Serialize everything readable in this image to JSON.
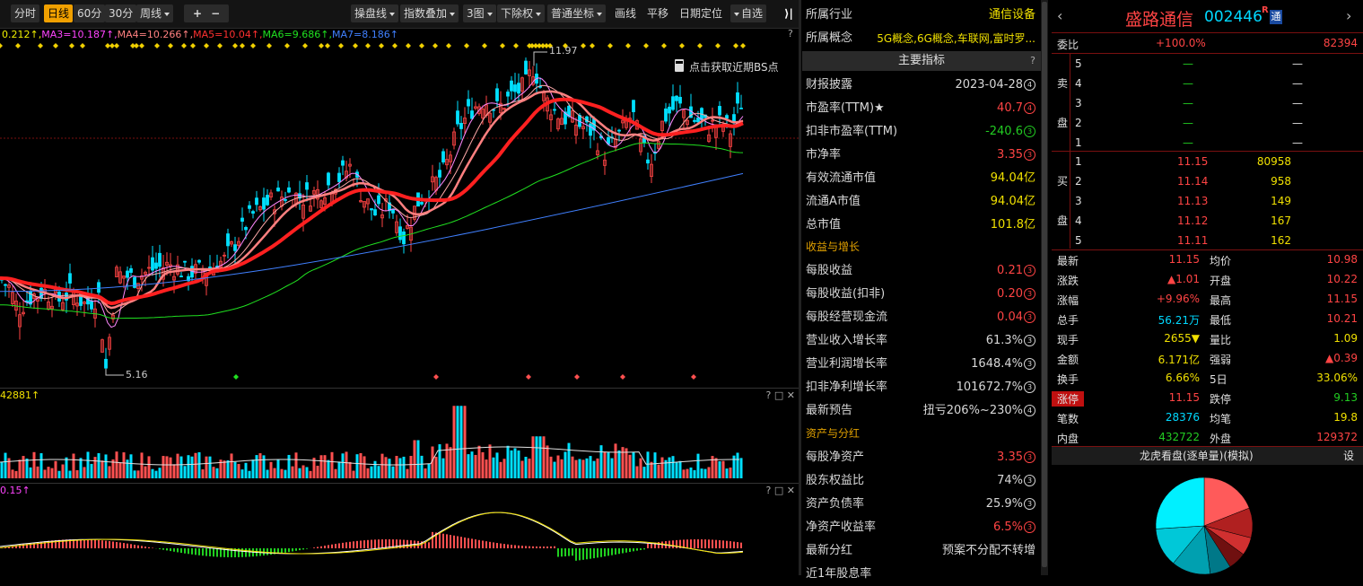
{
  "toolbar": {
    "tabs": [
      "分时",
      "日线",
      "60分",
      "30分",
      "周线"
    ],
    "active_tab": "日线",
    "plus": "+",
    "minus": "−",
    "tools": [
      "操盘线",
      "指数叠加",
      "3图",
      "下除权",
      "普通坐标",
      "画线",
      "平移",
      "日期定位",
      "自选"
    ]
  },
  "ma_legend": [
    {
      "text": "0.212↑,",
      "color": "#f0f000"
    },
    {
      "text": "MA3=10.187↑,",
      "color": "#ff44ff"
    },
    {
      "text": "MA4=10.266↑,",
      "color": "#ff8080"
    },
    {
      "text": "MA5=10.04↑,",
      "color": "#ff2020"
    },
    {
      "text": "MA6=9.686↑,",
      "color": "#20e020"
    },
    {
      "text": "MA7=8.186↑",
      "color": "#4080ff"
    }
  ],
  "chart": {
    "lock_hint": "点击获取近期BS点",
    "high_label": "11.97",
    "low_label": "5.16",
    "volume_legend": "42881↑",
    "macd_legend": "0.15↑",
    "question": "?"
  },
  "chart_data": {
    "type": "candlestick",
    "ylim": [
      4.9,
      12.4
    ],
    "price_points": [
      [
        0,
        7.2
      ],
      [
        10,
        7.0
      ],
      [
        20,
        6.5
      ],
      [
        35,
        6.8
      ],
      [
        50,
        6.9
      ],
      [
        65,
        6.7
      ],
      [
        80,
        6.9
      ],
      [
        95,
        6.6
      ],
      [
        110,
        6.8
      ],
      [
        118,
        5.16
      ],
      [
        130,
        7.3
      ],
      [
        150,
        7.2
      ],
      [
        170,
        7.4
      ],
      [
        190,
        7.5
      ],
      [
        210,
        7.3
      ],
      [
        230,
        7.4
      ],
      [
        250,
        7.6
      ],
      [
        265,
        8.1
      ],
      [
        280,
        8.6
      ],
      [
        300,
        8.9
      ],
      [
        320,
        9.1
      ],
      [
        340,
        9.0
      ],
      [
        360,
        9.2
      ],
      [
        375,
        9.4
      ],
      [
        390,
        9.7
      ],
      [
        405,
        9.0
      ],
      [
        420,
        8.6
      ],
      [
        435,
        8.9
      ],
      [
        450,
        8.1
      ],
      [
        465,
        8.9
      ],
      [
        480,
        9.2
      ],
      [
        495,
        9.6
      ],
      [
        510,
        10.5
      ],
      [
        525,
        11.0
      ],
      [
        540,
        11.2
      ],
      [
        555,
        11.0
      ],
      [
        570,
        11.3
      ],
      [
        585,
        11.5
      ],
      [
        595,
        11.97
      ],
      [
        605,
        11.3
      ],
      [
        620,
        10.9
      ],
      [
        640,
        10.7
      ],
      [
        660,
        10.5
      ],
      [
        675,
        10.0
      ],
      [
        690,
        10.4
      ],
      [
        705,
        10.9
      ],
      [
        715,
        10.1
      ],
      [
        725,
        9.8
      ],
      [
        740,
        10.8
      ],
      [
        755,
        11.1
      ],
      [
        770,
        10.8
      ],
      [
        790,
        10.6
      ],
      [
        805,
        10.7
      ],
      [
        815,
        10.5
      ],
      [
        825,
        11.15
      ]
    ],
    "ma_series": [
      {
        "name": "MA5",
        "color": "#ff2020"
      },
      {
        "name": "MA4",
        "color": "#ff8080"
      },
      {
        "name": "MA6",
        "color": "#20e020"
      },
      {
        "name": "MA7",
        "color": "#4080ff"
      }
    ]
  },
  "info": {
    "industry_label": "所属行业",
    "industry_value": "通信设备",
    "concept_label": "所属概念",
    "concept_value": "5G概念,6G概念,车联网,富时罗...",
    "indicators_title": "主要指标",
    "rows_a": [
      {
        "label": "财报披露",
        "value": "2023-04-28",
        "tag": "4",
        "color": "#d8d8d8"
      },
      {
        "label": "市盈率(TTM)★",
        "value": "40.7",
        "tag": "4",
        "color": "#ff4444"
      },
      {
        "label": "扣非市盈率(TTM)",
        "value": "-240.6",
        "tag": "3",
        "color": "#22cc22"
      },
      {
        "label": "市净率",
        "value": "3.35",
        "tag": "3",
        "color": "#ff4444"
      },
      {
        "label": "有效流通市值",
        "value": "94.04亿",
        "tag": "",
        "color": "#f0e000"
      },
      {
        "label": "流通A市值",
        "value": "94.04亿",
        "tag": "",
        "color": "#f0e000"
      },
      {
        "label": "总市值",
        "value": "101.8亿",
        "tag": "",
        "color": "#f0e000"
      }
    ],
    "section_growth": "收益与增长",
    "rows_b": [
      {
        "label": "每股收益",
        "value": "0.21",
        "tag": "3",
        "color": "#ff4444"
      },
      {
        "label": "每股收益(扣非)",
        "value": "0.20",
        "tag": "3",
        "color": "#ff4444"
      },
      {
        "label": "每股经营现金流",
        "value": "0.04",
        "tag": "3",
        "color": "#ff4444"
      },
      {
        "label": "营业收入增长率",
        "value": "61.3%",
        "tag": "3",
        "color": "#d8d8d8"
      },
      {
        "label": "营业利润增长率",
        "value": "1648.4%",
        "tag": "3",
        "color": "#d8d8d8"
      },
      {
        "label": "扣非净利增长率",
        "value": "101672.7%",
        "tag": "3",
        "color": "#d8d8d8"
      },
      {
        "label": "最新预告",
        "value": "扭亏206%~230%",
        "tag": "4",
        "color": "#d8d8d8"
      }
    ],
    "section_assets": "资产与分红",
    "rows_c": [
      {
        "label": "每股净资产",
        "value": "3.35",
        "tag": "3",
        "color": "#ff4444"
      },
      {
        "label": "股东权益比",
        "value": "74%",
        "tag": "3",
        "color": "#d8d8d8"
      },
      {
        "label": "资产负债率",
        "value": "25.9%",
        "tag": "3",
        "color": "#d8d8d8"
      },
      {
        "label": "净资产收益率",
        "value": "6.5%",
        "tag": "3",
        "color": "#ff4444"
      },
      {
        "label": "最新分红",
        "value": "预案不分配不转增",
        "tag": "",
        "color": "#d8d8d8"
      },
      {
        "label": "近1年股息率",
        "value": "",
        "tag": "",
        "color": "#d8d8d8"
      }
    ]
  },
  "quote": {
    "name": "盛路通信",
    "code": "002446",
    "badge_r": "R",
    "badge_tong": "通",
    "weibi_label": "委比",
    "weibi_value": "+100.0%",
    "weibi_count": "82394",
    "sell_label": [
      "卖",
      "盘"
    ],
    "buy_label": [
      "买",
      "盘"
    ],
    "sells": [
      {
        "lvl": "5",
        "price": "—",
        "vol": "—"
      },
      {
        "lvl": "4",
        "price": "—",
        "vol": "—"
      },
      {
        "lvl": "3",
        "price": "—",
        "vol": "—"
      },
      {
        "lvl": "2",
        "price": "—",
        "vol": "—"
      },
      {
        "lvl": "1",
        "price": "—",
        "vol": "—"
      }
    ],
    "buys": [
      {
        "lvl": "1",
        "price": "11.15",
        "vol": "80958"
      },
      {
        "lvl": "2",
        "price": "11.14",
        "vol": "958"
      },
      {
        "lvl": "3",
        "price": "11.13",
        "vol": "149"
      },
      {
        "lvl": "4",
        "price": "11.12",
        "vol": "167"
      },
      {
        "lvl": "5",
        "price": "11.11",
        "vol": "162"
      }
    ],
    "stats": [
      {
        "l1": "最新",
        "v1": "11.15",
        "c1": "#ff4444",
        "l2": "均价",
        "v2": "10.98",
        "c2": "#ff4444"
      },
      {
        "l1": "涨跌",
        "v1": "▲1.01",
        "c1": "#ff4444",
        "l2": "开盘",
        "v2": "10.22",
        "c2": "#ff4444"
      },
      {
        "l1": "涨幅",
        "v1": "+9.96%",
        "c1": "#ff4444",
        "l2": "最高",
        "v2": "11.15",
        "c2": "#ff4444"
      },
      {
        "l1": "总手",
        "v1": "56.21万",
        "c1": "#00d8ff",
        "l2": "最低",
        "v2": "10.21",
        "c2": "#ff4444"
      },
      {
        "l1": "现手",
        "v1": "2655▼",
        "c1": "#f0e000",
        "l2": "量比",
        "v2": "1.09",
        "c2": "#f0e000"
      },
      {
        "l1": "金额",
        "v1": "6.171亿",
        "c1": "#f0e000",
        "l2": "强弱",
        "v2": "▲0.39",
        "c2": "#ff4444"
      },
      {
        "l1": "换手",
        "v1": "6.66%",
        "c1": "#f0e000",
        "l2": "5日",
        "v2": "33.06%",
        "c2": "#f0e000"
      },
      {
        "l1": "涨停",
        "v1": "11.15",
        "c1": "#ff4444",
        "l2": "跌停",
        "v2": "9.13",
        "c2": "#22cc22"
      },
      {
        "l1": "笔数",
        "v1": "28376",
        "c1": "#00d8ff",
        "l2": "均笔",
        "v2": "19.8",
        "c2": "#f0e000"
      },
      {
        "l1": "内盘",
        "v1": "432722",
        "c1": "#22cc22",
        "l2": "外盘",
        "v2": "129372",
        "c2": "#ff4444"
      }
    ],
    "dragon_title": "龙虎看盘(逐单量)(模拟)",
    "settings": "设"
  },
  "colors": {
    "up": "#ff4444",
    "down": "#00e0ff",
    "ma5": "#ff2020",
    "ma6": "#20e020",
    "ma7": "#4080ff"
  }
}
